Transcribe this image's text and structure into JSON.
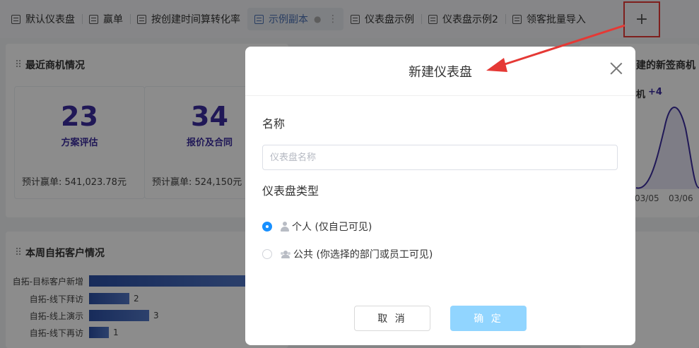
{
  "tabs": [
    {
      "label": "默认仪表盘"
    },
    {
      "label": "赢单"
    },
    {
      "label": "按创建时间算转化率"
    },
    {
      "label": "示例副本",
      "active": true
    },
    {
      "label": "仪表盘示例"
    },
    {
      "label": "仪表盘示例2"
    },
    {
      "label": "领客批量导入"
    }
  ],
  "add_button": {
    "label": "+"
  },
  "cards": {
    "recent": {
      "title": "最近商机情况",
      "stats": [
        {
          "value": "23",
          "label": "方案评估",
          "amount": "预计赢单: 541,023.78元"
        },
        {
          "value": "34",
          "label": "报价及合同",
          "amount": "预计赢单: 524,150元"
        }
      ]
    },
    "right": {
      "title": "建的新签商机",
      "legend": "机",
      "badge": "+4",
      "dates": [
        "03/05",
        "03/06"
      ]
    },
    "weekly": {
      "title": "本周自拓客户情况",
      "bars": [
        {
          "label": "自拓-目标客户新增",
          "value": ""
        },
        {
          "label": "自拓-线下拜访",
          "value": "2"
        },
        {
          "label": "自拓-线上演示",
          "value": "3"
        },
        {
          "label": "自拓-线下再访",
          "value": "1"
        }
      ]
    }
  },
  "modal": {
    "title": "新建仪表盘",
    "name_label": "名称",
    "name_placeholder": "仪表盘名称",
    "type_label": "仪表盘类型",
    "options": [
      {
        "label": "个人 (仅自己可见)",
        "checked": true
      },
      {
        "label": "公共 (你选择的部门或员工可见)",
        "checked": false
      }
    ],
    "cancel_label": "取 消",
    "ok_label": "确 定"
  },
  "colors": {
    "primary": "#1890ff",
    "ok_disabled": "#91d5ff",
    "stat_text": "#3b2d9e",
    "annotation": "#e53935"
  }
}
